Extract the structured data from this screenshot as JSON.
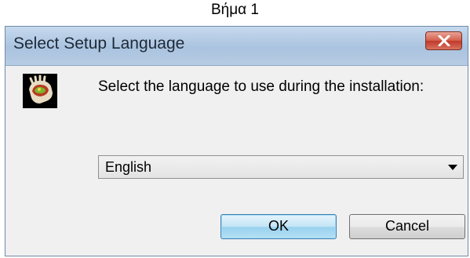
{
  "caption": "Βήμα 1",
  "window": {
    "title": "Select Setup Language",
    "close_icon": "close-x-icon"
  },
  "content": {
    "app_icon": "setup-app-icon",
    "prompt": "Select the language to use during the installation:",
    "language_select": {
      "selected": "English",
      "arrow_icon": "dropdown-arrow-icon"
    }
  },
  "buttons": {
    "ok_label": "OK",
    "cancel_label": "Cancel"
  },
  "colors": {
    "titlebar": "#b7cce4",
    "close_button": "#c0392b",
    "dialog_background": "#f0f0f0",
    "ok_focus": "#98d1ef"
  }
}
